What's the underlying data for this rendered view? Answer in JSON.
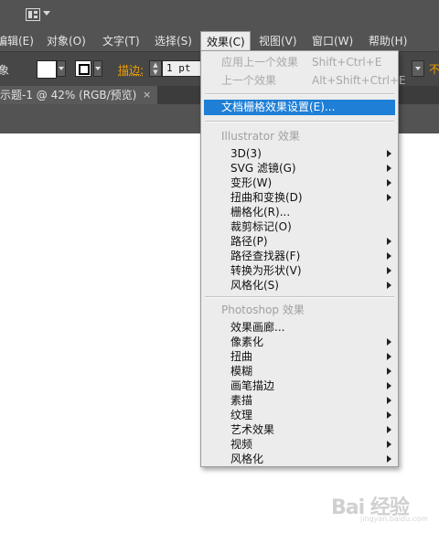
{
  "menubar": {
    "items": [
      "编辑(E)",
      "对象(O)",
      "文字(T)",
      "选择(S)",
      "效果(C)",
      "视图(V)",
      "窗口(W)",
      "帮助(H)"
    ]
  },
  "controlbar": {
    "left_label_cut": "象",
    "stroke_label": "描边:",
    "stroke_value": "1 pt",
    "right_cut": "不"
  },
  "document_tab": {
    "title": "示题-1 @ 42% (RGB/预览)",
    "close": "×"
  },
  "effect_menu": {
    "apply_last": {
      "label": "应用上一个效果",
      "shortcut": "Shift+Ctrl+E"
    },
    "last_effect": {
      "label": "上一个效果",
      "shortcut": "Alt+Shift+Ctrl+E"
    },
    "document_raster_settings": "文档栅格效果设置(E)...",
    "illustrator_header": "Illustrator 效果",
    "illustrator_items": [
      "3D(3)",
      "SVG 滤镜(G)",
      "变形(W)",
      "扭曲和变换(D)",
      "栅格化(R)...",
      "裁剪标记(O)",
      "路径(P)",
      "路径查找器(F)",
      "转换为形状(V)",
      "风格化(S)"
    ],
    "photoshop_header": "Photoshop 效果",
    "photoshop_items": [
      "效果画廊...",
      "像素化",
      "扭曲",
      "模糊",
      "画笔描边",
      "素描",
      "纹理",
      "艺术效果",
      "视频",
      "风格化"
    ]
  },
  "watermark": {
    "text": "Bai 经验",
    "url": "jingyan.baidu.com"
  }
}
